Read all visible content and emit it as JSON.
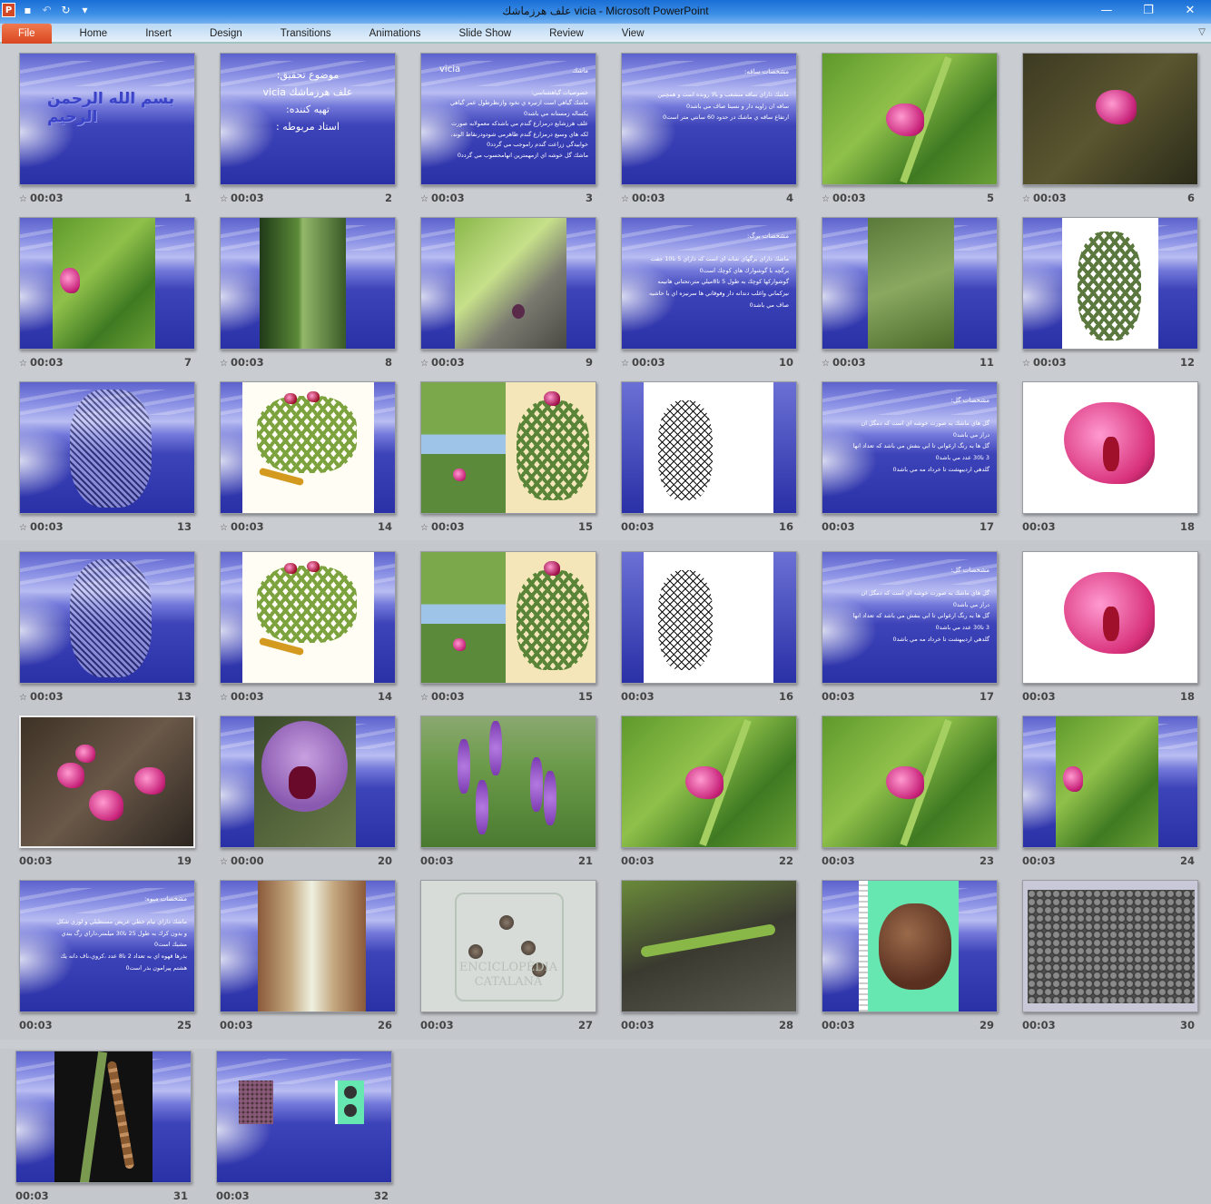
{
  "window": {
    "title": "علف هرزماشك vicia  -  Microsoft PowerPoint",
    "app_icon": "P",
    "controls": [
      "minimize-icon",
      "restore-icon",
      "close-icon"
    ]
  },
  "quick_access": [
    "save-icon",
    "undo-icon",
    "redo-icon",
    "customize-icon"
  ],
  "ribbon": {
    "tabs": [
      "File",
      "Home",
      "Insert",
      "Design",
      "Transitions",
      "Animations",
      "Slide Show",
      "Review",
      "View"
    ],
    "active": "File",
    "accent": "#d9461f"
  },
  "slides_top": [
    {
      "n": "1",
      "time": "00:03",
      "anim": true,
      "visual": "calligraphy",
      "logo_text": "بسم الله الرحمن الرحيم"
    },
    {
      "n": "2",
      "time": "00:03",
      "anim": true,
      "visual": "title",
      "lines": [
        "موضوع تحقيق:",
        "علف هرزماشك vicia",
        "تهيه كننده:",
        "استاد مربوطه :"
      ]
    },
    {
      "n": "3",
      "time": "00:03",
      "anim": true,
      "visual": "text",
      "title": "ماشك",
      "title_left": "vicia",
      "lines": [
        "خصوصيات گياهشناسي:",
        "ماشك گياهي است ازتيره ي نخود وازنظرطول عمر گياهي",
        "يكساله زمستانه مي باشد0",
        "علف هرزشايع درمزارع گندم مي باشدكه معمولابه صورت",
        "لكه هاي وسيع درمزارع گندم ظاهرمي شودودرنقاط الوند،",
        "خوابيدگي زراعت گندم راموجب مي گردد0",
        "ماشك گل خوشه اي ازمهمترين انهامحسوب مي گردد0"
      ]
    },
    {
      "n": "4",
      "time": "00:03",
      "anim": true,
      "visual": "text",
      "title": "مشخصات ساقه:",
      "lines": [
        "ماشك داراي ساقه منشعب و بالا رونده است و همچنين",
        "ساقه ان زاويه دار و نسبتا صاف مي باشد0",
        "ارتفاع ساقه ي ماشك در حدود 60 سانتي متر است0"
      ]
    },
    {
      "n": "5",
      "time": "00:03",
      "anim": true,
      "visual": "photo-green-pink"
    },
    {
      "n": "6",
      "time": "00:03",
      "anim": true,
      "visual": "photo-dark-pink"
    },
    {
      "n": "7",
      "time": "00:03",
      "anim": true,
      "visual": "inset-green-pink"
    },
    {
      "n": "8",
      "time": "00:03",
      "anim": true,
      "visual": "inset-dark-stem"
    },
    {
      "n": "9",
      "time": "00:03",
      "anim": true,
      "visual": "inset-leaves"
    },
    {
      "n": "10",
      "time": "00:03",
      "anim": true,
      "visual": "text",
      "title": "مشخصات برگ:",
      "lines": [
        "ماشك داراي برگهاي شانه اي است كه داراي 5 تا10 جفت",
        "برگچه با گوشوارك هاي كوچك است0",
        "گوشواركها كوچك به طول 5 تا8ميلي متر،تحتاني هانيمه",
        "نيزكماني واغلب دندانه دار وفوقاني ها سرنيزه اي با حاشيه",
        "صاف مي باشد0"
      ]
    },
    {
      "n": "11",
      "time": "00:03",
      "anim": true,
      "visual": "inset-green"
    },
    {
      "n": "12",
      "time": "00:03",
      "anim": true,
      "visual": "inset-white-botanical"
    },
    {
      "n": "13",
      "time": "00:03",
      "anim": true,
      "visual": "sketch-plant"
    },
    {
      "n": "14",
      "time": "00:03",
      "anim": true,
      "visual": "inset-botanical-color"
    },
    {
      "n": "15",
      "time": "00:03",
      "anim": true,
      "visual": "collage"
    },
    {
      "n": "16",
      "time": "00:03",
      "anim": false,
      "visual": "inset-drawing"
    },
    {
      "n": "17",
      "time": "00:03",
      "anim": false,
      "visual": "text",
      "title": "مشخصات گل:",
      "lines": [
        "گل هاي ماشك به صورت خوشه اي است كه دمگل ان",
        "دراز مي باشد0",
        "گل ها به رنگ ارغواني تا ابي بنفش مي باشد كه تعداد انها",
        "3 تا30 عدد مي باشد0",
        "گلدهي ارديبهشت تا خرداد مه مي باشد0"
      ]
    },
    {
      "n": "18",
      "time": "00:03",
      "anim": false,
      "visual": "white-pink-flower"
    }
  ],
  "slides_bottom": [
    {
      "n": "13",
      "time": "00:03",
      "anim": true,
      "visual": "sketch-plant"
    },
    {
      "n": "14",
      "time": "00:03",
      "anim": true,
      "visual": "inset-botanical-color"
    },
    {
      "n": "15",
      "time": "00:03",
      "anim": true,
      "visual": "collage"
    },
    {
      "n": "16",
      "time": "00:03",
      "anim": false,
      "visual": "inset-drawing"
    },
    {
      "n": "17",
      "time": "00:03",
      "anim": false,
      "visual": "text",
      "title": "مشخصات گل:",
      "lines": [
        "گل هاي ماشك به صورت خوشه اي است كه دمگل ان",
        "دراز مي باشد0",
        "گل ها به رنگ ارغواني تا ابي بنفش مي باشد كه تعداد انها",
        "3 تا30 عدد مي باشد0",
        "گلدهي ارديبهشت تا خرداد مه مي باشد0"
      ]
    },
    {
      "n": "18",
      "time": "00:03",
      "anim": false,
      "visual": "white-pink-flower"
    },
    {
      "n": "19",
      "time": "00:03",
      "anim": false,
      "visual": "photo-dark-pink-many"
    },
    {
      "n": "20",
      "time": "00:00",
      "anim": true,
      "visual": "inset-purple-flower"
    },
    {
      "n": "21",
      "time": "00:03",
      "anim": false,
      "visual": "photo-meadow"
    },
    {
      "n": "22",
      "time": "00:03",
      "anim": false,
      "visual": "photo-green-pink"
    },
    {
      "n": "23",
      "time": "00:03",
      "anim": false,
      "visual": "photo-green-pink"
    },
    {
      "n": "24",
      "time": "00:03",
      "anim": false,
      "visual": "inset-green-pink"
    },
    {
      "n": "25",
      "time": "00:03",
      "anim": false,
      "visual": "text",
      "title": "مشخصات ميوه:",
      "lines": [
        "ماشك داراي نيام خطي عريض مستطيلي و لوزي شكل",
        "و بدون كرك به طول 25 تا30 ميلمتر،داراي رگ بندي",
        "مشبك است0",
        "بذرها قهوه اي به تعداد 2 تا8 عدد ،كروي،ناف دانه يك",
        "هشتم پيرامون بذر است0"
      ]
    },
    {
      "n": "26",
      "time": "00:03",
      "anim": false,
      "visual": "inset-pod"
    },
    {
      "n": "27",
      "time": "00:03",
      "anim": false,
      "visual": "seeds-watermark",
      "watermark": "ENCICLOPÈDIA CATALANA"
    },
    {
      "n": "28",
      "time": "00:03",
      "anim": false,
      "visual": "photo-pod"
    },
    {
      "n": "29",
      "time": "00:03",
      "anim": false,
      "visual": "inset-seed-teal"
    },
    {
      "n": "30",
      "time": "00:03",
      "anim": false,
      "visual": "seed-pile"
    },
    {
      "n": "31",
      "time": "00:03",
      "anim": false,
      "visual": "inset-dark-pod"
    },
    {
      "n": "32",
      "time": "00:03",
      "anim": false,
      "visual": "two-small-images"
    }
  ]
}
